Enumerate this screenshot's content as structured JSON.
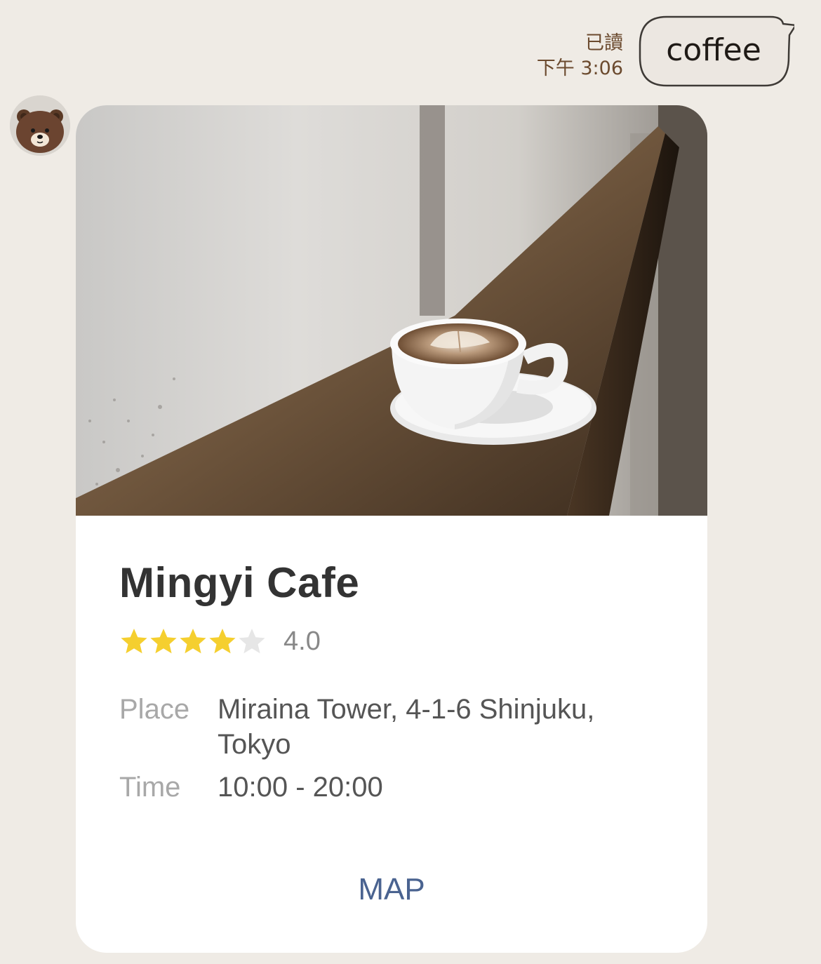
{
  "outgoing": {
    "read_status": "已讀",
    "time": "下午 3:06",
    "message": "coffee"
  },
  "avatar": {
    "icon": "bear-avatar-icon"
  },
  "card": {
    "image": "coffee-cup-on-counter-photo",
    "title": "Mingyi Cafe",
    "rating": {
      "stars_filled": 4,
      "stars_total": 5,
      "value_text": "4.0"
    },
    "rows": [
      {
        "label": "Place",
        "value": "Miraina Tower, 4-1-6 Shinjuku, Tokyo"
      },
      {
        "label": "Time",
        "value": "10:00 - 20:00"
      }
    ],
    "action_label": "MAP"
  },
  "colors": {
    "background": "#efebe5",
    "star_filled": "#f5cf2f",
    "star_empty": "#e6e6e6",
    "link": "#4a6390"
  }
}
